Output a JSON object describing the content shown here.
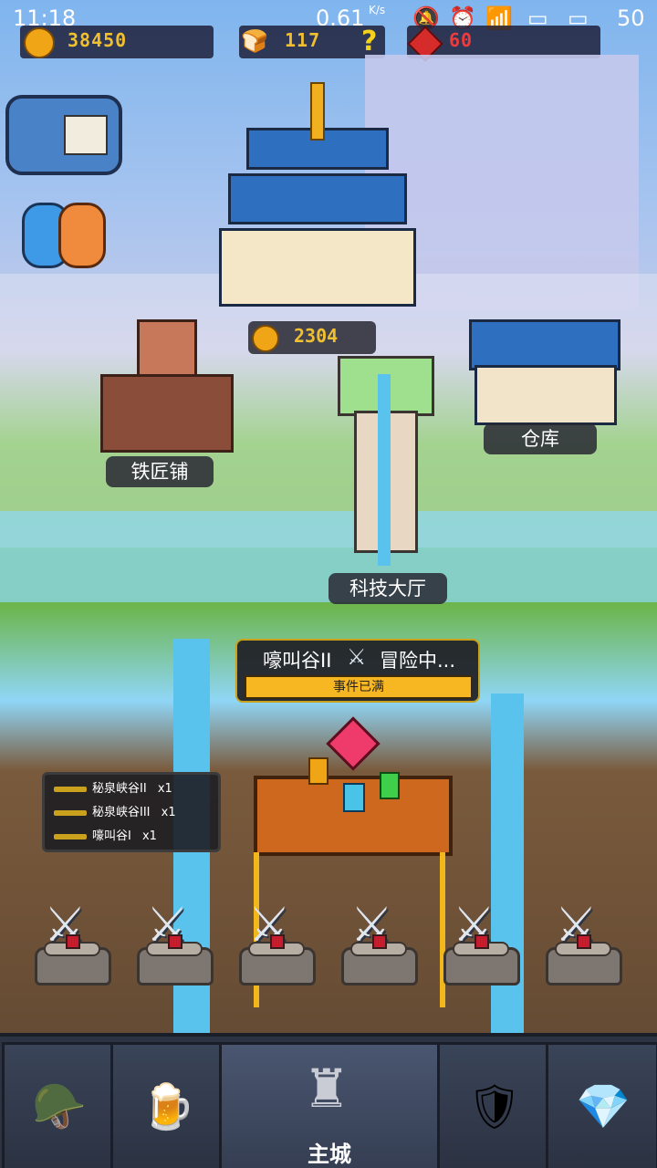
{
  "status_bar": {
    "time": "11:18",
    "net_speed": "0.61",
    "net_unit": "K/s",
    "battery": "50"
  },
  "resources": {
    "gold": "38450",
    "food": "117",
    "help_symbol": "?",
    "gems": "60"
  },
  "buildings": {
    "palace_income": "2304",
    "blacksmith": "铁匠铺",
    "warehouse": "仓库",
    "tech_hall": "科技大厅"
  },
  "adventure": {
    "location": "嚎叫谷II",
    "status": "冒险中...",
    "bar_text": "事件已满"
  },
  "queue": [
    {
      "name": "秘泉峡谷II",
      "count": "x1"
    },
    {
      "name": "秘泉峡谷III",
      "count": "x1"
    },
    {
      "name": "嚎叫谷I",
      "count": "x1"
    }
  ],
  "nav": {
    "main_city": "主城"
  },
  "colors": {
    "gold_text": "#f0c030",
    "gem_text": "#ef3b3b",
    "bar_fill": "#f6b723"
  },
  "icons": [
    "gold-coin-icon",
    "food-icon",
    "help-icon",
    "gem-icon",
    "mailbox-icon",
    "friends-icon",
    "crossed-swords-icon",
    "castle-icon",
    "beer-mug-icon",
    "shield-icon",
    "gift-icon",
    "hero-icon"
  ]
}
